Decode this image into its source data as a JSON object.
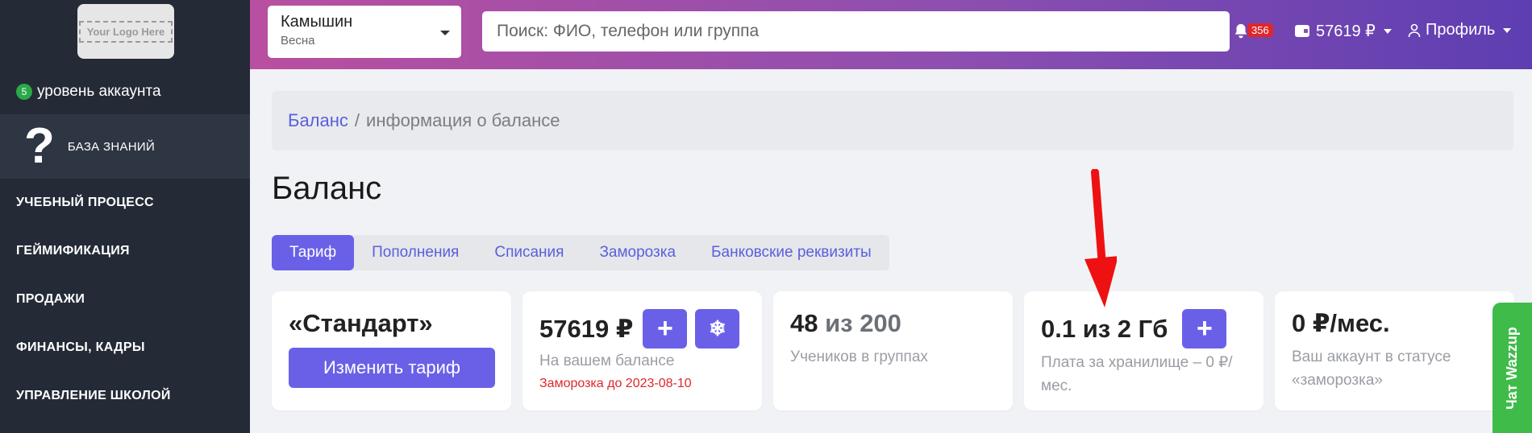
{
  "sidebar": {
    "logo_text": "Your Logo Here",
    "level_number": "5",
    "level_label": "уровень аккаунта",
    "knowledge_label": "БАЗА ЗНАНИЙ",
    "nav": [
      "УЧЕБНЫЙ ПРОЦЕСС",
      "ГЕЙМИФИКАЦИЯ",
      "ПРОДАЖИ",
      "ФИНАНСЫ, КАДРЫ",
      "УПРАВЛЕНИЕ ШКОЛОЙ"
    ]
  },
  "header": {
    "school_name": "Камышин",
    "school_season": "Весна",
    "search_placeholder": "Поиск: ФИО, телефон или группа",
    "notifications_count": "356",
    "balance": "57619 ₽",
    "profile_label": "Профиль"
  },
  "breadcrumb": {
    "link": "Баланс",
    "separator": "/",
    "current": "информация о балансе"
  },
  "page_title": "Баланс",
  "tabs": [
    "Тариф",
    "Пополнения",
    "Списания",
    "Заморозка",
    "Банковские реквизиты"
  ],
  "cards": {
    "tariff": {
      "name": "«Стандарт»",
      "button": "Изменить тариф"
    },
    "balance": {
      "amount": "57619 ₽",
      "label": "На вашем балансе",
      "freeze_note": "Заморозка до 2023-08-10",
      "add_glyph": "+",
      "freeze_glyph": "❄"
    },
    "students": {
      "count": "48",
      "of_total": "из 200",
      "label": "Учеников в группах"
    },
    "storage": {
      "usage": "0.1 из 2 Гб",
      "label": "Плата за хранилище – 0 ₽/мес.",
      "add_glyph": "+"
    },
    "fee": {
      "amount": "0 ₽/мес.",
      "label": "Ваш аккаунт в статусе «заморозка»"
    }
  },
  "chat_widget": "Чат Wazzup",
  "colors": {
    "accent": "#6a60e8",
    "sidebar": "#242a36",
    "header_start": "#b94fa0",
    "header_end": "#5d3eb2",
    "arrow": "#ee1111",
    "chat": "#3fbb4a"
  }
}
